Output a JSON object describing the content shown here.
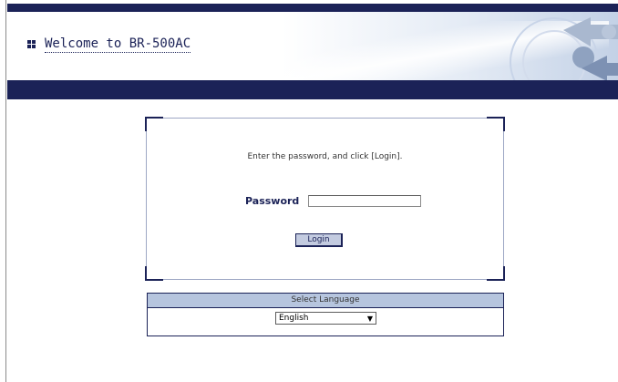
{
  "header": {
    "title": "Welcome to BR-500AC"
  },
  "login": {
    "instruction": "Enter the password, and click [Login].",
    "password_label": "Password",
    "password_value": "",
    "login_button": "Login"
  },
  "language": {
    "heading": "Select Language",
    "selected": "English"
  },
  "colors": {
    "navy": "#1b2257",
    "lang_header_bg": "#b6c5de",
    "button_bg": "#c3cbe0"
  },
  "icons": {
    "title_bullet": "grid-bullet-icon",
    "header_graphic": "network-arrows-icon",
    "select_caret": "chevron-down-icon"
  }
}
